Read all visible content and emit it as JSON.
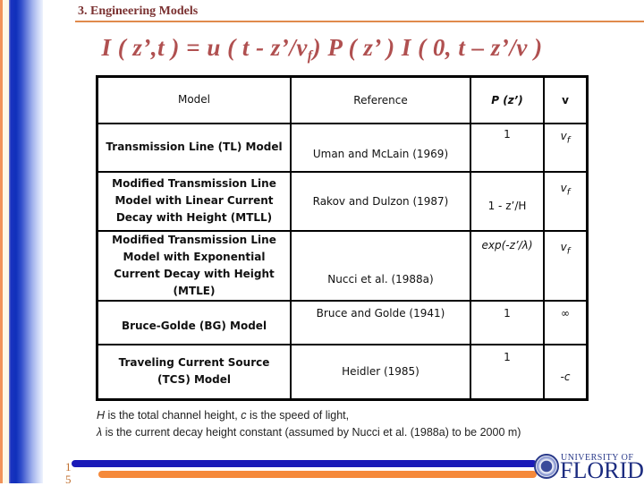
{
  "section_title": "3. Engineering Models",
  "equation": {
    "lhs": "I ( z’,t ) = u ( t - z’/v",
    "sub": "f",
    "rhs": ") P ( z’ ) I ( 0, t – z’/v )"
  },
  "table": {
    "headers": {
      "model": "Model",
      "reference": "Reference",
      "pz": "P (z’)",
      "v": "v"
    },
    "rows": [
      {
        "model": "Transmission Line (TL) Model",
        "reference": "Uman and McLain (1969)",
        "pz": "1",
        "v_main": "v",
        "v_sub": "f"
      },
      {
        "model": "Modified Transmission Line Model with Linear Current Decay with Height (MTLL)",
        "reference": "Rakov and Dulzon (1987)",
        "pz": "1 - z’/H",
        "v_main": "v",
        "v_sub": "f"
      },
      {
        "model": "Modified Transmission Line Model with Exponential Current Decay with Height (MTLE)",
        "reference": "Nucci et al. (1988a)",
        "pz": "exp(-z’/λ)",
        "v_main": "v",
        "v_sub": "f"
      },
      {
        "model": "Bruce-Golde (BG) Model",
        "reference": "Bruce and Golde (1941)",
        "pz": "1",
        "v_main": "∞",
        "v_sub": ""
      },
      {
        "model": "Traveling Current Source (TCS) Model",
        "reference": "Heidler (1985)",
        "pz": "1",
        "v_main": "-c",
        "v_sub": ""
      }
    ]
  },
  "notes": {
    "line1_sym1": "H",
    "line1_text1": " is the total channel height, ",
    "line1_sym2": "c",
    "line1_text2": " is the speed of light,",
    "line2_sym": "λ",
    "line2_text": " is the current decay height constant (assumed by Nucci et al. (1988a) to be 2000 m)"
  },
  "footer": {
    "page_number_line1": "1",
    "page_number_line2": "5",
    "logo_line1": "UNIVERSITY OF",
    "logo_line2": "FLORIDA"
  },
  "colors": {
    "title": "#7a3030",
    "equation": "#b05050",
    "header_accent": "#1e2fc0",
    "bar_blue": "#1a1ab8",
    "bar_orange": "#f5893a"
  }
}
